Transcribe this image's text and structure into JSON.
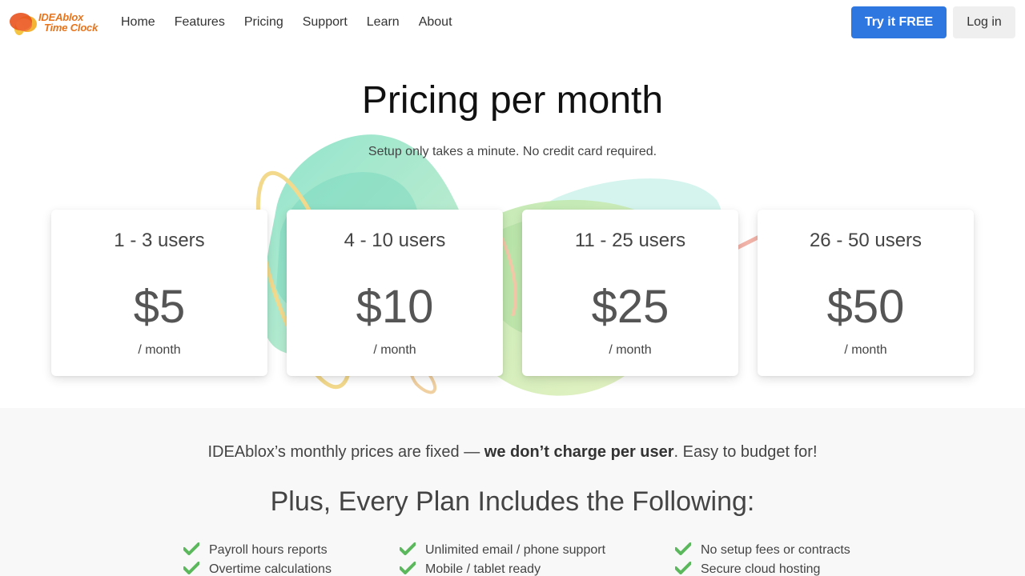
{
  "nav": {
    "logo_line1": "IDEAblox",
    "logo_line2": "Time Clock",
    "links": [
      "Home",
      "Features",
      "Pricing",
      "Support",
      "Learn",
      "About"
    ],
    "try_label": "Try it FREE",
    "login_label": "Log in"
  },
  "hero": {
    "title": "Pricing per month",
    "subtitle": "Setup only takes a minute. No credit card required."
  },
  "plans": [
    {
      "users": "1 - 3 users",
      "price": "$5",
      "per": "/ month"
    },
    {
      "users": "4 - 10 users",
      "price": "$10",
      "per": "/ month"
    },
    {
      "users": "11 - 25 users",
      "price": "$25",
      "per": "/ month"
    },
    {
      "users": "26 - 50 users",
      "price": "$50",
      "per": "/ month"
    }
  ],
  "note": {
    "before": "IDEAblox’s monthly prices are fixed — ",
    "bold": "we don’t charge per user",
    "after": ". Easy to budget for!"
  },
  "features": {
    "heading": "Plus, Every Plan Includes the Following:",
    "col1": [
      "Payroll hours reports",
      "Overtime calculations"
    ],
    "col2": [
      "Unlimited email / phone support",
      "Mobile / tablet ready"
    ],
    "col3": [
      "No setup fees or contracts",
      "Secure cloud hosting"
    ]
  },
  "colors": {
    "accent": "#2f77e0",
    "logo": "#e8731a",
    "check": "#5cb85c"
  }
}
